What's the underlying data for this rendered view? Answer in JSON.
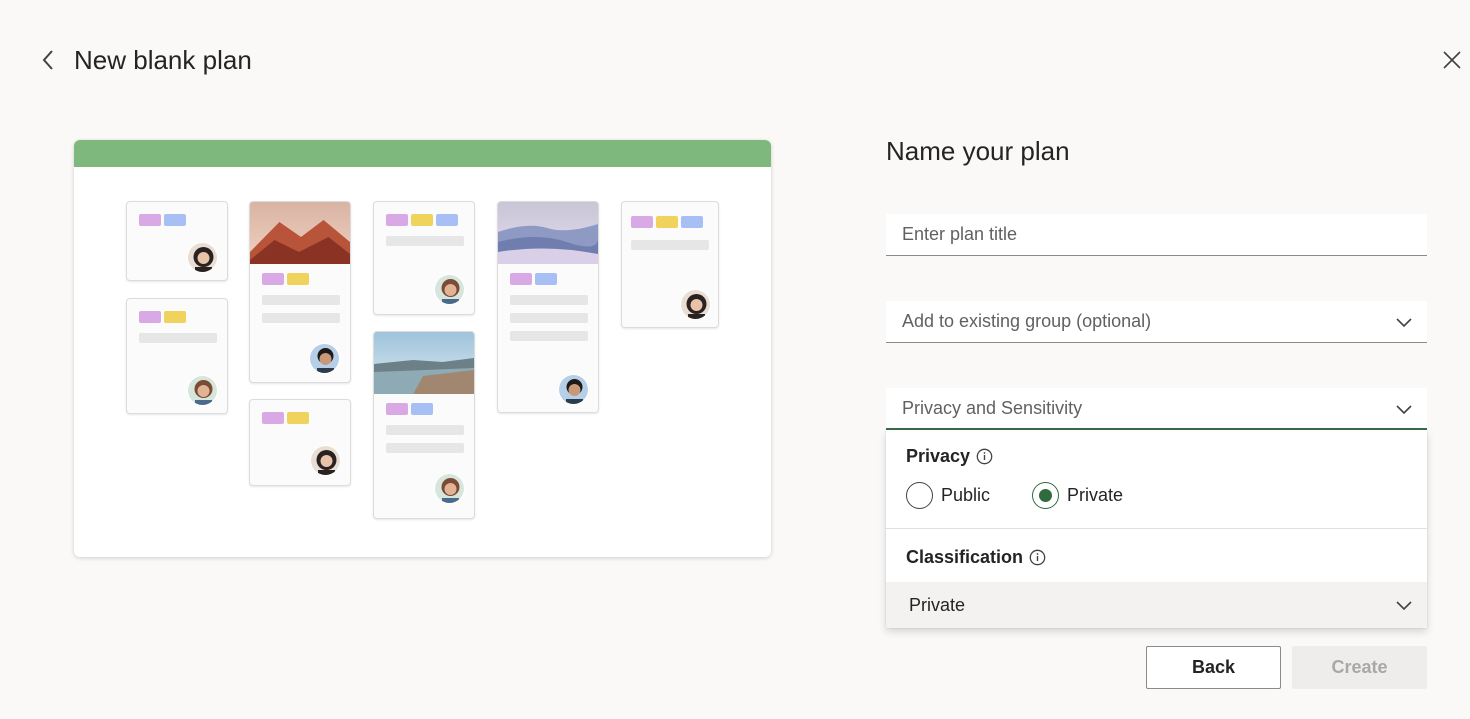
{
  "header": {
    "title": "New blank plan",
    "back_icon": "chevron-left-icon",
    "close_icon": "close-icon"
  },
  "form": {
    "title": "Name your plan",
    "plan_title_placeholder": "Enter plan title",
    "group_placeholder": "Add to existing group (optional)",
    "privacy_dropdown_label": "Privacy and Sensitivity"
  },
  "panel": {
    "privacy_label": "Privacy",
    "options": [
      {
        "label": "Public",
        "selected": false
      },
      {
        "label": "Private",
        "selected": true
      }
    ],
    "classification_label": "Classification",
    "classification_value": "Private"
  },
  "buttons": {
    "back": "Back",
    "create": "Create"
  },
  "colors": {
    "accent": "#2f6b3c",
    "preview_bar": "#7eb87d",
    "tag_pink": "#d9a9e6",
    "tag_yellow": "#efd35c",
    "tag_blue": "#a8bff5"
  }
}
